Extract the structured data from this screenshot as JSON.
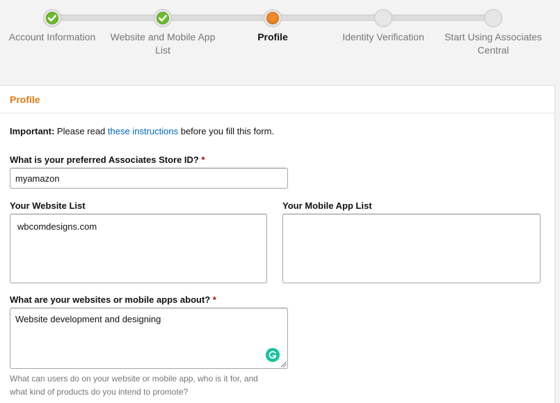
{
  "stepper": {
    "steps": [
      {
        "label_line1": "Account Information",
        "label_line2": "",
        "state": "done"
      },
      {
        "label_line1": "Website and Mobile App",
        "label_line2": "List",
        "state": "done"
      },
      {
        "label_line1": "Profile",
        "label_line2": "",
        "state": "current"
      },
      {
        "label_line1": "Identity Verification",
        "label_line2": "",
        "state": "pending"
      },
      {
        "label_line1": "Start Using Associates",
        "label_line2": "Central",
        "state": "pending"
      }
    ],
    "colors": {
      "done": "#6dbb2f",
      "current": "#f0892a",
      "pending": "#e6e6e6"
    }
  },
  "panel": {
    "title": "Profile",
    "important_label": "Important:",
    "important_pre": "Please read",
    "important_link": "these instructions",
    "important_post": "before you fill this form."
  },
  "form": {
    "store_id": {
      "label": "What is your preferred Associates Store ID?",
      "required_mark": "*",
      "value": "myamazon"
    },
    "website_list": {
      "label": "Your Website List",
      "value": "wbcomdesigns.com"
    },
    "mobile_app_list": {
      "label": "Your Mobile App List",
      "value": ""
    },
    "about": {
      "label": "What are your websites or mobile apps about?",
      "required_mark": "*",
      "value": "Website development and designing",
      "hint": "What can users do on your website or mobile app, who is it for, and what kind of products do you intend to promote?"
    }
  },
  "icons": {
    "check": "checkmark-icon",
    "grammarly": "grammarly-icon",
    "resize": "resize-grip-icon"
  }
}
